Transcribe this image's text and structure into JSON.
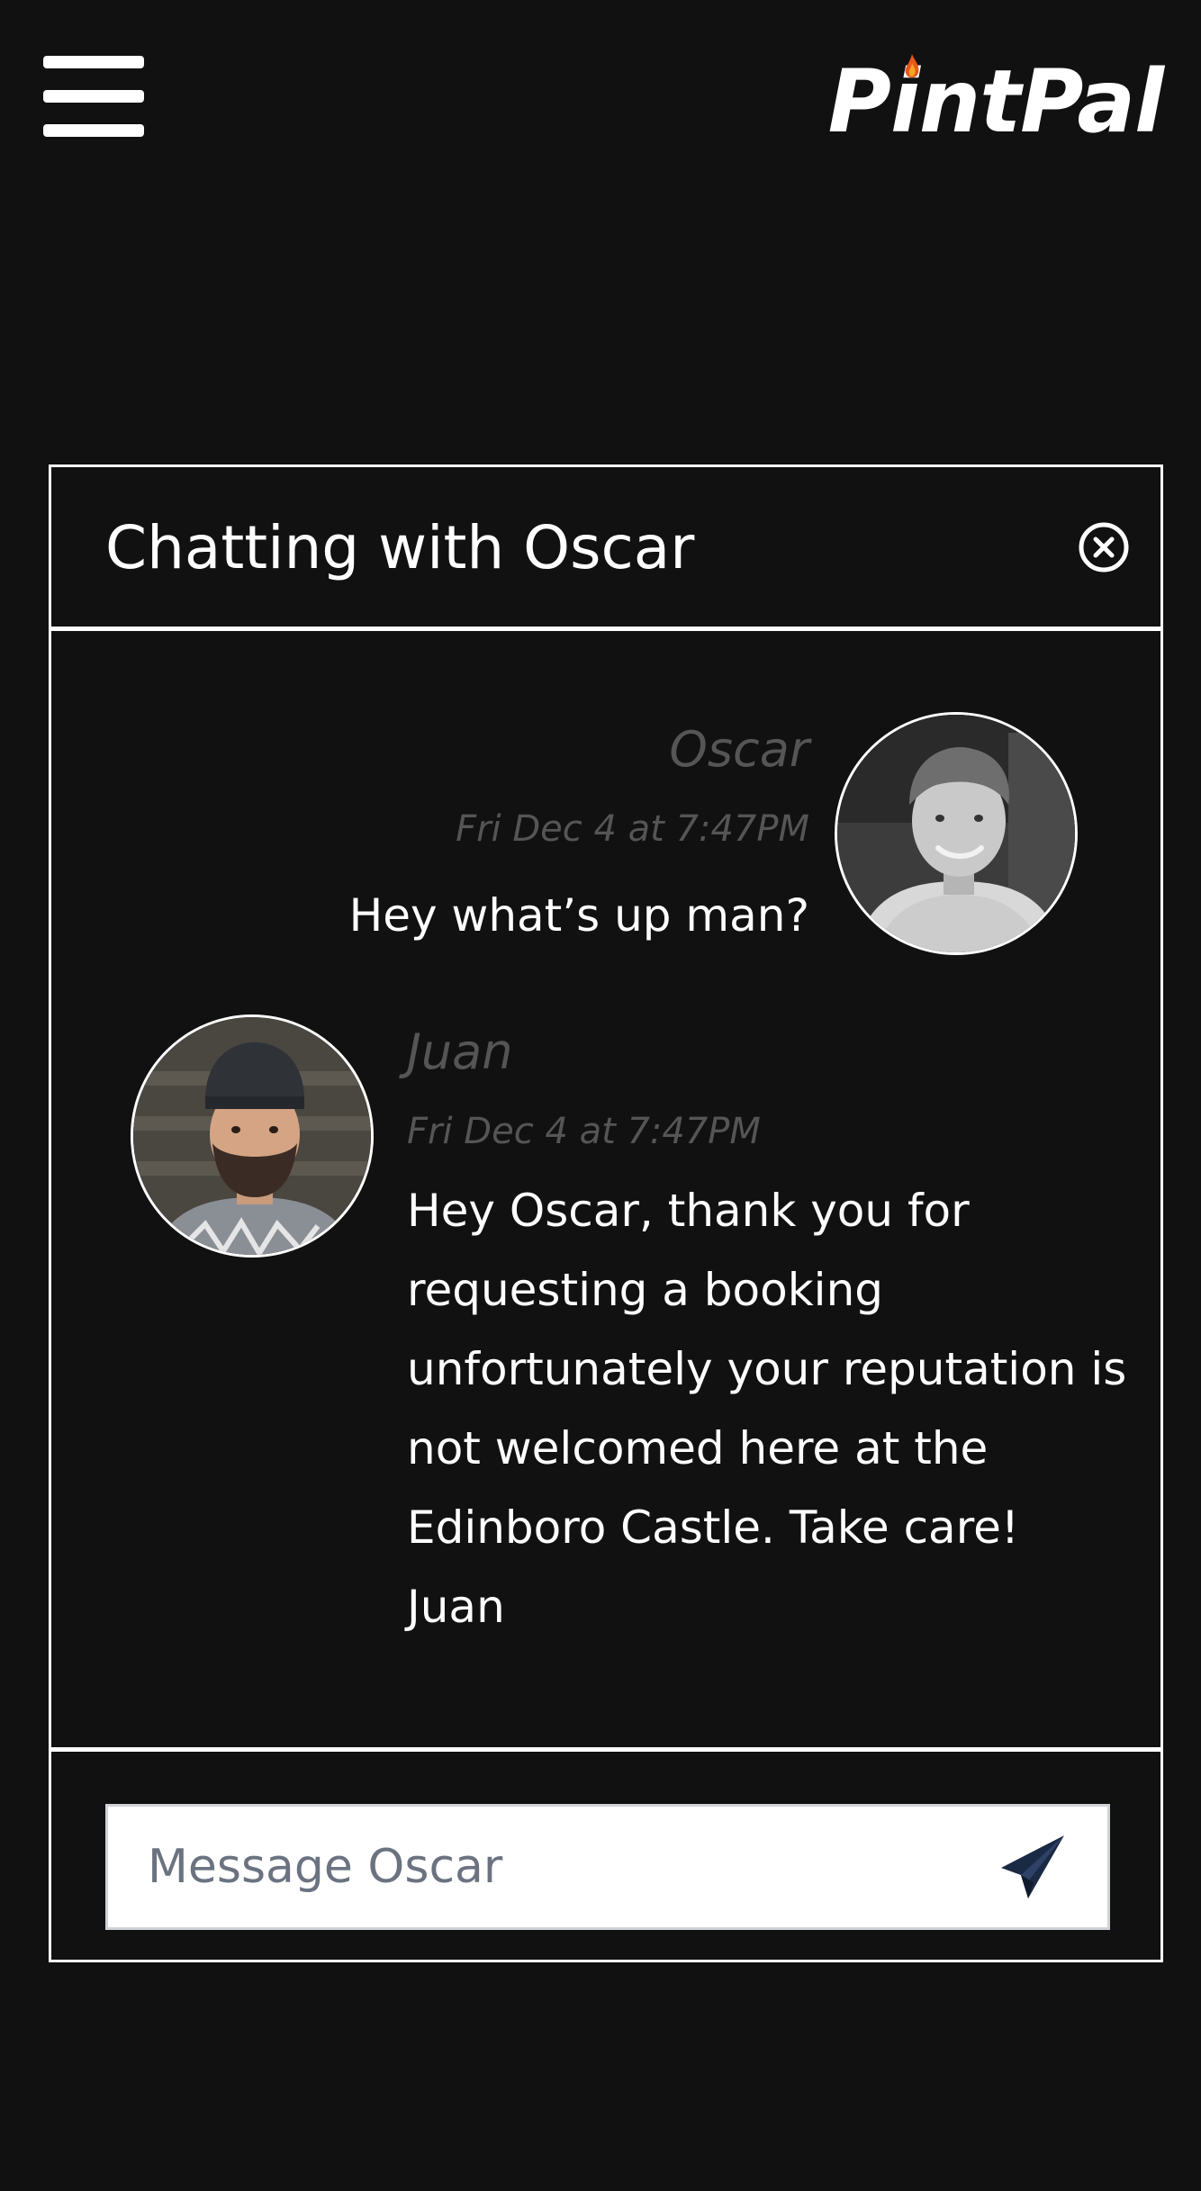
{
  "header": {
    "menu_icon": "hamburger-menu-icon",
    "logo_text": "PintPal"
  },
  "chat": {
    "title": "Chatting with Oscar",
    "close_icon": "close-circle-icon",
    "messages": [
      {
        "sender": "Oscar",
        "timestamp": "Fri Dec 4 at 7:47PM",
        "text": "Hey what’s up man?",
        "align": "right"
      },
      {
        "sender": "Juan",
        "timestamp": "Fri Dec 4 at 7:47PM",
        "text": "Hey Oscar, thank you for requesting a booking unfortunately your reputation is not welcomed here at the Edinboro Castle. Take care! Juan",
        "align": "left"
      }
    ],
    "input": {
      "placeholder": "Message Oscar",
      "value": "",
      "send_icon": "paper-plane-send-icon",
      "send_icon_color": "#1b2a44"
    }
  },
  "colors": {
    "background": "#111111",
    "text": "#ffffff",
    "muted": "#555555",
    "border": "#ffffff"
  }
}
